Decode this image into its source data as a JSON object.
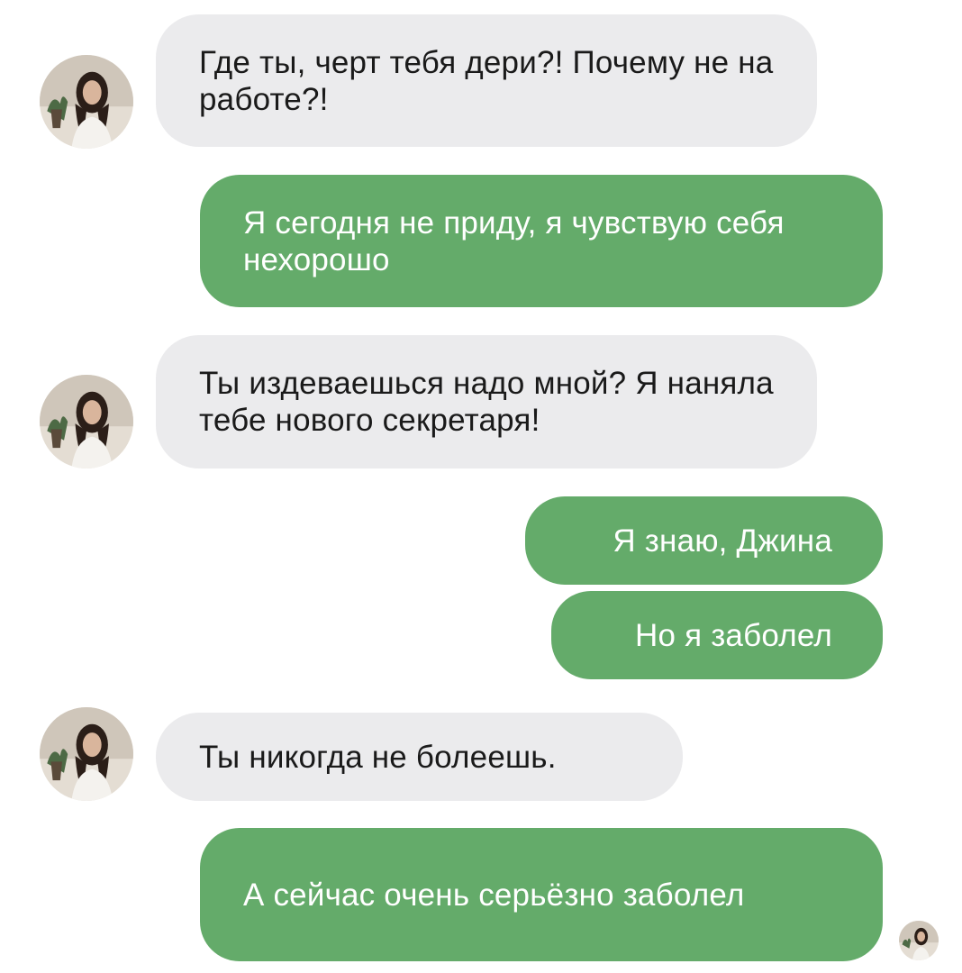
{
  "messages": [
    {
      "side": "incoming",
      "text": "Где ты, черт тебя дери?! Почему не на работе?!"
    },
    {
      "side": "outgoing",
      "text": "Я сегодня не приду, я чувствую себя нехорошо"
    },
    {
      "side": "incoming",
      "text": "Ты издеваешься надо мной? Я наняла тебе нового секретаря!"
    },
    {
      "side": "outgoing",
      "text": "Я знаю, Джина"
    },
    {
      "side": "outgoing",
      "text": "Но я заболел"
    },
    {
      "side": "incoming",
      "text": "Ты никогда не болеешь."
    },
    {
      "side": "outgoing",
      "text": "А сейчас очень серьёзно заболел"
    }
  ],
  "colors": {
    "incoming_bubble": "#ebebed",
    "outgoing_bubble": "#64ab6a",
    "incoming_text": "#1a1a1a",
    "outgoing_text": "#ffffff",
    "background": "#ffffff"
  },
  "icons": {
    "contact_avatar": "avatar-photo",
    "read_receipt": "avatar-photo"
  }
}
